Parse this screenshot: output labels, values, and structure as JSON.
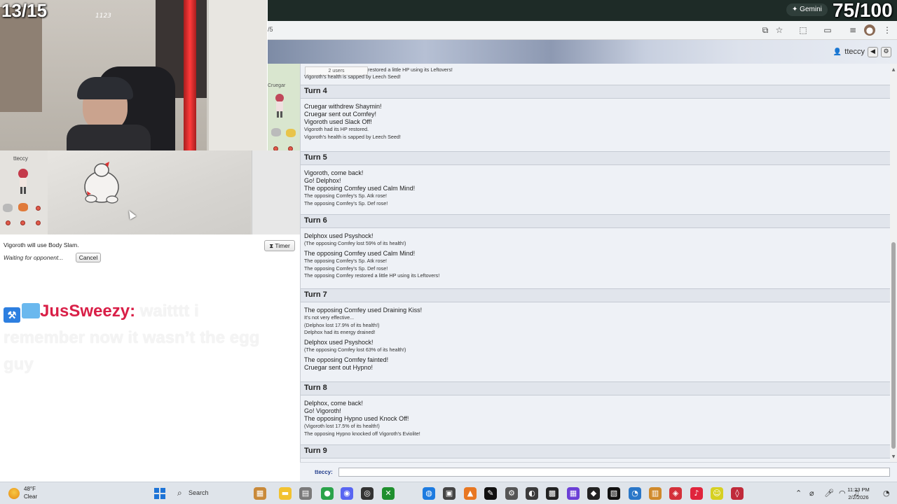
{
  "overlay": {
    "counter_left": "13/15",
    "counter_right": "75/100",
    "cam_text": "1123"
  },
  "browser": {
    "address_fragment": "/5",
    "gemini_label": "Gemini"
  },
  "header": {
    "username": "tteccy",
    "back_icon": "chevron-left-icon",
    "settings_icon": "gear-icon"
  },
  "battle": {
    "trainer_name": "tteccy",
    "opponent_name": "Cruegar",
    "users_count": "2 users",
    "status_text": "Vigoroth will use Body Slam.",
    "waiting_text": "Waiting for opponent...",
    "cancel_label": "Cancel",
    "timer_label": "Timer"
  },
  "chat_overlay": {
    "user": "JusSweezy:",
    "message": "waitttt i remember now it wasn’t the egg guy"
  },
  "log": {
    "top_lines": [
      "restored a little HP using its Leftovers!",
      "Vigoroth's health is sapped by Leech Seed!"
    ],
    "turns": [
      {
        "label": "Turn 4",
        "lines": [
          {
            "t": "Cruegar withdrew Shaymin!",
            "s": false
          },
          {
            "t": "Cruegar sent out Comfey!",
            "s": false
          },
          {
            "t": "Vigoroth used Slack Off!",
            "s": false
          },
          {
            "t": "Vigoroth had its HP restored.",
            "s": true
          },
          {
            "t": "Vigoroth's health is sapped by Leech Seed!",
            "s": true
          }
        ]
      },
      {
        "label": "Turn 5",
        "lines": [
          {
            "t": "Vigoroth, come back!",
            "s": false
          },
          {
            "t": "Go! Delphox!",
            "s": false
          },
          {
            "t": "The opposing Comfey used Calm Mind!",
            "s": false
          },
          {
            "t": "The opposing Comfey's Sp. Atk rose!",
            "s": true
          },
          {
            "t": "The opposing Comfey's Sp. Def rose!",
            "s": true
          }
        ]
      },
      {
        "label": "Turn 6",
        "lines": [
          {
            "t": "Delphox used Psyshock!",
            "s": false
          },
          {
            "t": "(The opposing Comfey lost 59% of its health!)",
            "s": true
          },
          {
            "t": "The opposing Comfey used Calm Mind!",
            "s": false
          },
          {
            "t": "The opposing Comfey's Sp. Atk rose!",
            "s": true
          },
          {
            "t": "The opposing Comfey's Sp. Def rose!",
            "s": true
          },
          {
            "t": "The opposing Comfey restored a little HP using its Leftovers!",
            "s": true
          }
        ]
      },
      {
        "label": "Turn 7",
        "lines": [
          {
            "t": "The opposing Comfey used Draining Kiss!",
            "s": false
          },
          {
            "t": "It's not very effective...",
            "s": true
          },
          {
            "t": "(Delphox lost 17.9% of its health!)",
            "s": true
          },
          {
            "t": "Delphox had its energy drained!",
            "s": true
          },
          {
            "t": "Delphox used Psyshock!",
            "s": false
          },
          {
            "t": "(The opposing Comfey lost 63% of its health!)",
            "s": true
          },
          {
            "t": "The opposing Comfey fainted!",
            "s": false
          },
          {
            "t": "Cruegar sent out Hypno!",
            "s": false
          }
        ]
      },
      {
        "label": "Turn 8",
        "lines": [
          {
            "t": "Delphox, come back!",
            "s": false
          },
          {
            "t": "Go! Vigoroth!",
            "s": false
          },
          {
            "t": "The opposing Hypno used Knock Off!",
            "s": false
          },
          {
            "t": "(Vigoroth lost 17.5% of its health!)",
            "s": true
          },
          {
            "t": "The opposing Hypno knocked off Vigoroth's Eviolite!",
            "s": true
          }
        ]
      },
      {
        "label": "Turn 9",
        "lines": []
      }
    ]
  },
  "chatbox": {
    "label": "tteccy:"
  },
  "taskbar": {
    "temperature": "48°F",
    "condition": "Clear",
    "search_label": "Search",
    "time": "11:23 PM",
    "date": "2/2/2026"
  }
}
